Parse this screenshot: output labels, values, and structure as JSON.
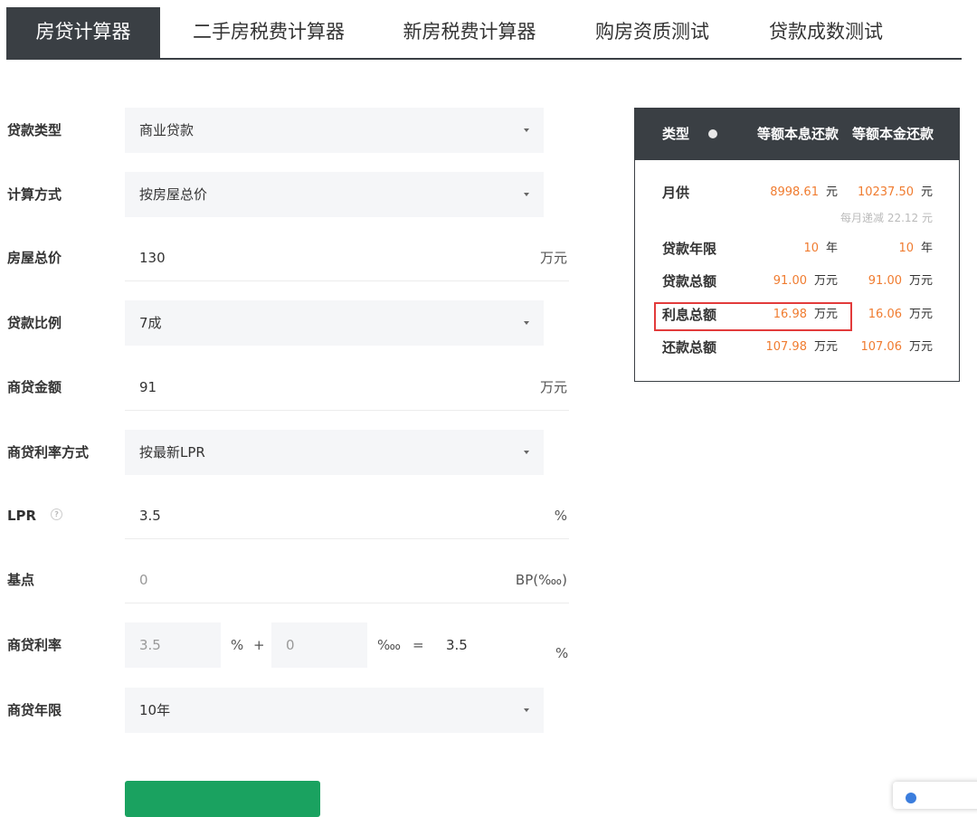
{
  "tabs": [
    {
      "label": "房贷计算器",
      "active": true
    },
    {
      "label": "二手房税费计算器",
      "active": false
    },
    {
      "label": "新房税费计算器",
      "active": false
    },
    {
      "label": "购房资质测试",
      "active": false
    },
    {
      "label": "贷款成数测试",
      "active": false
    }
  ],
  "form": {
    "loan_type": {
      "label": "贷款类型",
      "value": "商业贷款"
    },
    "calc_method": {
      "label": "计算方式",
      "value": "按房屋总价"
    },
    "house_price": {
      "label": "房屋总价",
      "value": "130",
      "unit": "万元"
    },
    "loan_ratio": {
      "label": "贷款比例",
      "value": "7成"
    },
    "commercial_amount": {
      "label": "商贷金额",
      "value": "91",
      "unit": "万元"
    },
    "rate_method": {
      "label": "商贷利率方式",
      "value": "按最新LPR"
    },
    "lpr": {
      "label": "LPR",
      "help": "?",
      "value": "3.5",
      "unit": "%"
    },
    "basis_point": {
      "label": "基点",
      "value": "0",
      "unit": "BP(‱)"
    },
    "commercial_rate": {
      "label": "商贷利率",
      "lpr_value": "3.5",
      "percent": "%",
      "plus": "+",
      "bp_value": "0",
      "permyriad": "‱",
      "equals": "=",
      "result": "3.5",
      "unit": "%"
    },
    "loan_term": {
      "label": "商贷年限",
      "value": "10年"
    }
  },
  "result": {
    "header": {
      "type": "类型",
      "col1": "等额本息还款",
      "col2": "等额本金还款"
    },
    "monthly": {
      "label": "月供",
      "v1": "8998.61",
      "u1": "元",
      "v2": "10237.50",
      "u2": "元",
      "note": "每月递减 22.12 元"
    },
    "years": {
      "label": "贷款年限",
      "v1": "10",
      "u1": "年",
      "v2": "10",
      "u2": "年"
    },
    "total_loan": {
      "label": "贷款总额",
      "v1": "91.00",
      "u1": "万元",
      "v2": "91.00",
      "u2": "万元"
    },
    "interest": {
      "label": "利息总额",
      "v1": "16.98",
      "u1": "万元",
      "v2": "16.06",
      "u2": "万元"
    },
    "repay": {
      "label": "还款总额",
      "v1": "107.98",
      "u1": "万元",
      "v2": "107.06",
      "u2": "万元"
    }
  },
  "colors": {
    "accent_dark": "#3a3f44",
    "value_orange": "#f07c30",
    "highlight_red": "#e23b3b",
    "button_green": "#1aa260"
  }
}
